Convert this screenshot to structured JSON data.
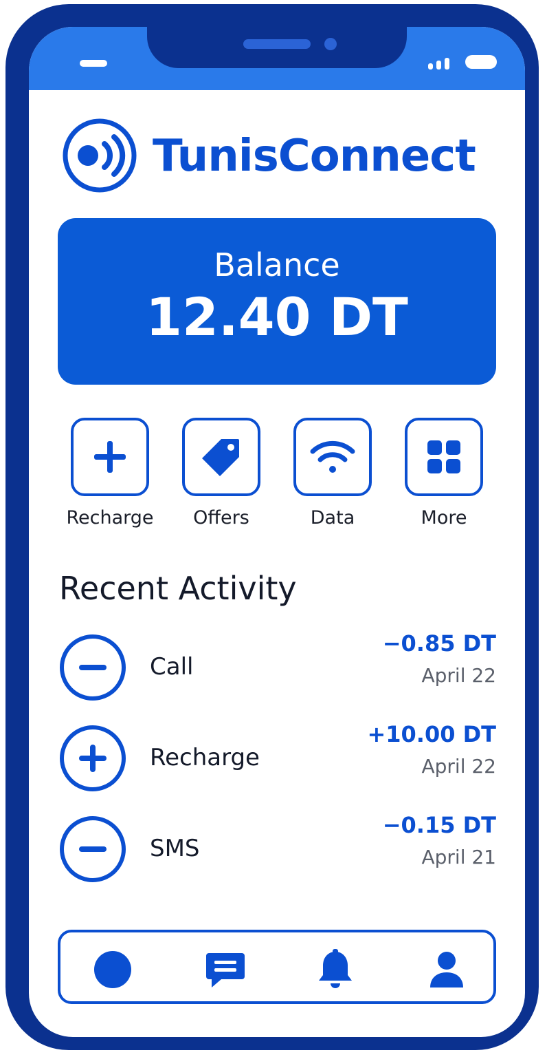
{
  "app": {
    "name": "TunisConnect"
  },
  "colors": {
    "brand": "#0b4fd1",
    "frame": "#0b318f",
    "statusbar": "#2a7aea",
    "card": "#0b5bd6"
  },
  "balance": {
    "label": "Balance",
    "value": "12.40 DT"
  },
  "actions": [
    {
      "label": "Recharge",
      "icon": "plus-icon"
    },
    {
      "label": "Offers",
      "icon": "tag-icon"
    },
    {
      "label": "Data",
      "icon": "wifi-icon"
    },
    {
      "label": "More",
      "icon": "grid-icon"
    }
  ],
  "recent": {
    "title": "Recent Activity",
    "items": [
      {
        "name": "Call",
        "amount": "−0.85 DT",
        "date": "April 22",
        "icon": "minus-circle-icon"
      },
      {
        "name": "Recharge",
        "amount": "+10.00 DT",
        "date": "April 22",
        "icon": "plus-circle-icon"
      },
      {
        "name": "SMS",
        "amount": "−0.15 DT",
        "date": "April 21",
        "icon": "minus-circle-icon"
      }
    ]
  },
  "tabbar": {
    "items": [
      {
        "icon": "home-circle-icon",
        "active": true
      },
      {
        "icon": "message-icon"
      },
      {
        "icon": "bell-icon"
      },
      {
        "icon": "profile-icon"
      }
    ]
  }
}
